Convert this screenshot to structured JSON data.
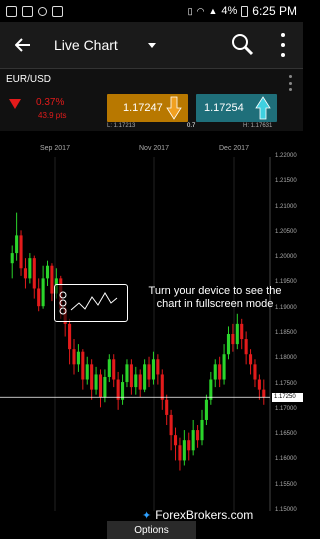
{
  "status_bar": {
    "time": "6:25 PM",
    "battery": "4%"
  },
  "app_bar": {
    "title": "Live Chart"
  },
  "quote": {
    "symbol": "EUR/USD",
    "change_pct": "0.37%",
    "change_pts": "43.9 pts",
    "sell_price": "1.17247",
    "buy_price": "1.17254",
    "low": "L: 1.17213",
    "spread": "0.7",
    "high": "H: 1.17631"
  },
  "colors": {
    "down": "#e31b1b",
    "up": "#2bd42b",
    "sell": "#b87800",
    "buy": "#1f6f7a"
  },
  "chart_data": {
    "type": "candlestick",
    "x_ticks": [
      "Sep 2017",
      "Nov 2017",
      "Dec 2017"
    ],
    "y_ticks": [
      "1.22000",
      "1.21500",
      "1.21000",
      "1.20500",
      "1.20000",
      "1.19500",
      "1.19000",
      "1.18500",
      "1.18000",
      "1.17500",
      "1.17000",
      "1.16500",
      "1.16000",
      "1.15500",
      "1.15000"
    ],
    "ylim": [
      1.15,
      1.22
    ],
    "current_price": "1.17250",
    "candles": [
      [
        1.199,
        1.201,
        1.196,
        1.2025
      ],
      [
        1.201,
        1.2045,
        1.1995,
        1.209
      ],
      [
        1.2045,
        1.198,
        1.1965,
        1.2055
      ],
      [
        1.198,
        1.196,
        1.194,
        1.2
      ],
      [
        1.196,
        1.2,
        1.195,
        1.201
      ],
      [
        1.2,
        1.194,
        1.192,
        1.2005
      ],
      [
        1.194,
        1.1905,
        1.1895,
        1.196
      ],
      [
        1.1905,
        1.196,
        1.19,
        1.1985
      ],
      [
        1.196,
        1.1985,
        1.1945,
        1.1995
      ],
      [
        1.1985,
        1.193,
        1.1915,
        1.199
      ],
      [
        1.193,
        1.196,
        1.192,
        1.198
      ],
      [
        1.196,
        1.19,
        1.188,
        1.1965
      ],
      [
        1.19,
        1.187,
        1.1845,
        1.1915
      ],
      [
        1.187,
        1.182,
        1.179,
        1.188
      ],
      [
        1.182,
        1.179,
        1.177,
        1.184
      ],
      [
        1.179,
        1.1815,
        1.1775,
        1.183
      ],
      [
        1.1815,
        1.176,
        1.174,
        1.182
      ],
      [
        1.176,
        1.179,
        1.175,
        1.1805
      ],
      [
        1.179,
        1.174,
        1.172,
        1.18
      ],
      [
        1.174,
        1.177,
        1.173,
        1.1785
      ],
      [
        1.177,
        1.1725,
        1.1705,
        1.178
      ],
      [
        1.1725,
        1.1765,
        1.1715,
        1.178
      ],
      [
        1.1765,
        1.18,
        1.1755,
        1.181
      ],
      [
        1.18,
        1.176,
        1.1745,
        1.181
      ],
      [
        1.176,
        1.172,
        1.17,
        1.1775
      ],
      [
        1.172,
        1.1755,
        1.171,
        1.177
      ],
      [
        1.1755,
        1.179,
        1.1745,
        1.18
      ],
      [
        1.179,
        1.1745,
        1.173,
        1.18
      ],
      [
        1.1745,
        1.177,
        1.173,
        1.1785
      ],
      [
        1.177,
        1.174,
        1.1725,
        1.178
      ],
      [
        1.174,
        1.179,
        1.1735,
        1.18
      ],
      [
        1.179,
        1.176,
        1.1745,
        1.1805
      ],
      [
        1.176,
        1.18,
        1.175,
        1.1815
      ],
      [
        1.18,
        1.177,
        1.175,
        1.181
      ],
      [
        1.177,
        1.172,
        1.17,
        1.178
      ],
      [
        1.172,
        1.169,
        1.167,
        1.173
      ],
      [
        1.169,
        1.165,
        1.162,
        1.17
      ],
      [
        1.165,
        1.163,
        1.16,
        1.1665
      ],
      [
        1.163,
        1.16,
        1.158,
        1.1645
      ],
      [
        1.16,
        1.164,
        1.159,
        1.166
      ],
      [
        1.164,
        1.162,
        1.16,
        1.1655
      ],
      [
        1.162,
        1.166,
        1.161,
        1.168
      ],
      [
        1.166,
        1.164,
        1.1625,
        1.167
      ],
      [
        1.164,
        1.168,
        1.163,
        1.17
      ],
      [
        1.168,
        1.172,
        1.167,
        1.173
      ],
      [
        1.172,
        1.176,
        1.171,
        1.1775
      ],
      [
        1.176,
        1.179,
        1.1745,
        1.18
      ],
      [
        1.179,
        1.176,
        1.1745,
        1.1805
      ],
      [
        1.176,
        1.181,
        1.175,
        1.183
      ],
      [
        1.181,
        1.185,
        1.18,
        1.1865
      ],
      [
        1.185,
        1.183,
        1.1815,
        1.187
      ],
      [
        1.183,
        1.187,
        1.182,
        1.189
      ],
      [
        1.187,
        1.184,
        1.182,
        1.188
      ],
      [
        1.184,
        1.181,
        1.179,
        1.1855
      ],
      [
        1.181,
        1.179,
        1.177,
        1.182
      ],
      [
        1.179,
        1.176,
        1.1745,
        1.18
      ],
      [
        1.176,
        1.174,
        1.172,
        1.177
      ],
      [
        1.174,
        1.1725,
        1.171,
        1.176
      ]
    ]
  },
  "overlay": {
    "message": "Turn your device to see the chart in fullscreen mode"
  },
  "footer": {
    "options_label": "Options",
    "watermark": "ForexBrokers.com"
  }
}
